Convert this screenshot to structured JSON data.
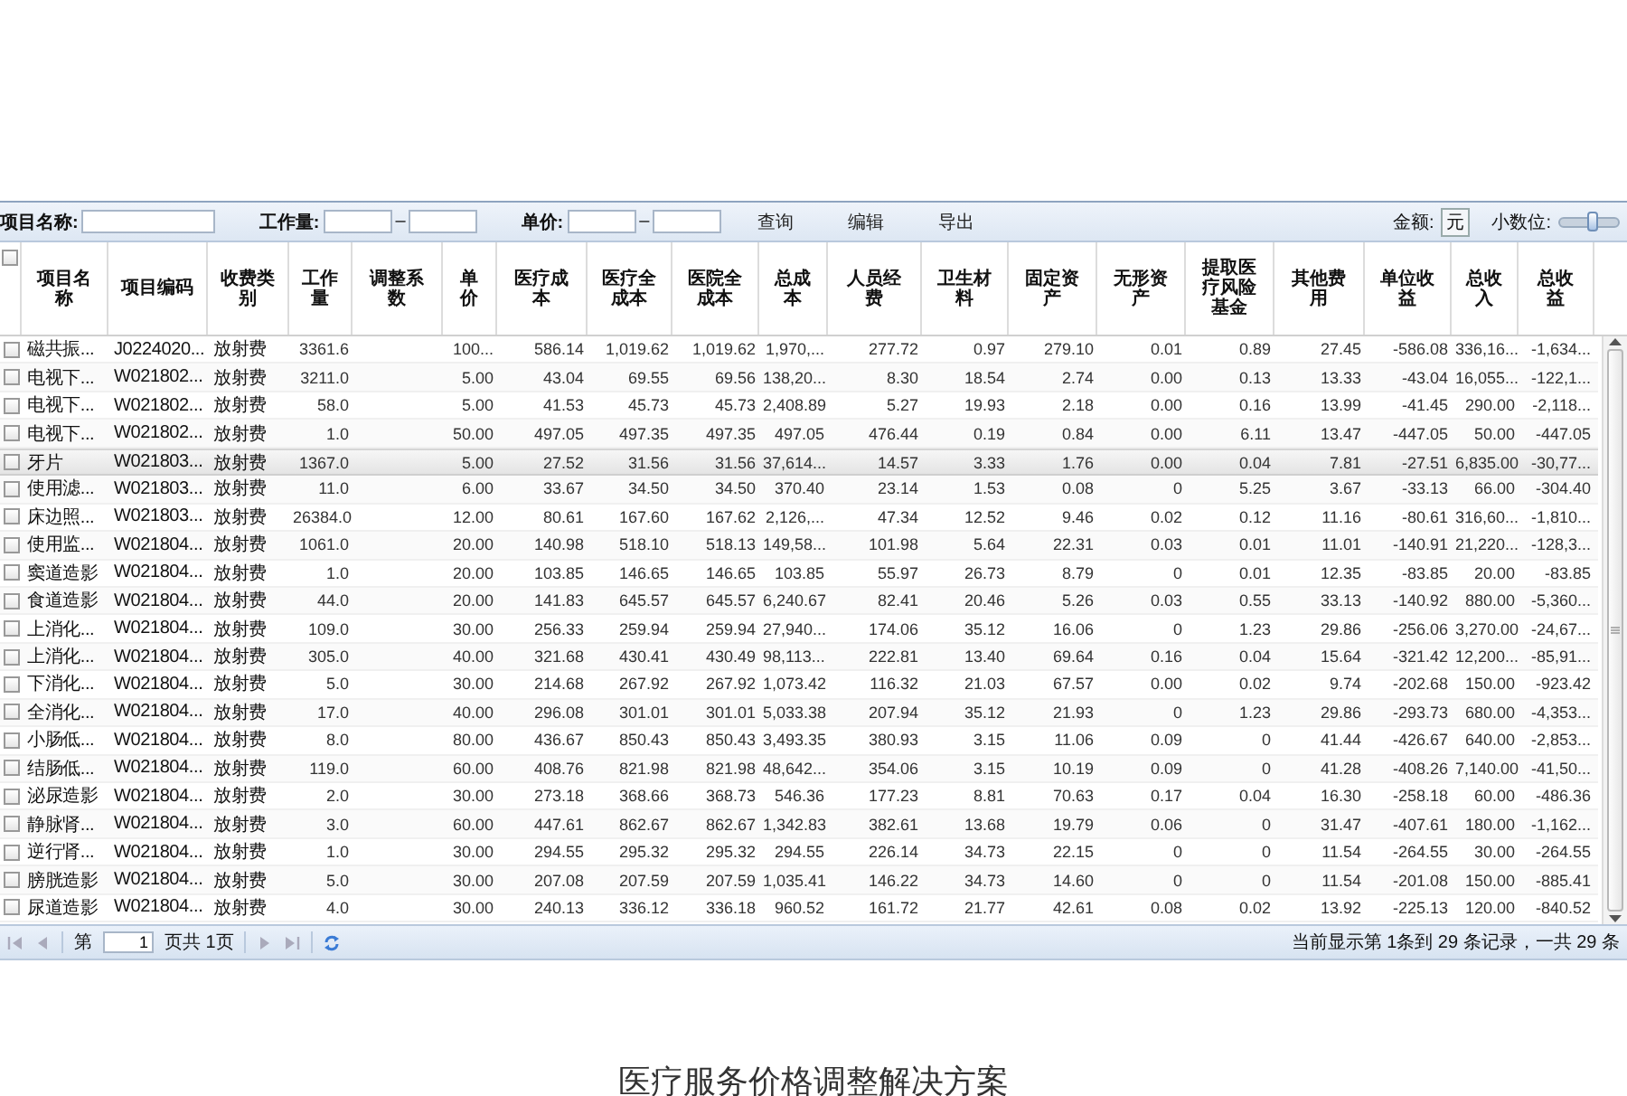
{
  "toolbar": {
    "filters": [
      {
        "label": "项目名称:",
        "kind": "text"
      },
      {
        "label": "工作量:",
        "kind": "range",
        "separator": "–"
      },
      {
        "label": "单价:",
        "kind": "range",
        "separator": "–"
      }
    ],
    "buttons": [
      "查询",
      "编辑",
      "导出"
    ],
    "amount_label": "金额:",
    "amount_unit": "元",
    "decimals_label": "小数位:",
    "decimals_slider": {
      "level": 0.55
    }
  },
  "table": {
    "select_all": {
      "checked": false
    },
    "columns": [
      {
        "label": "项目名称",
        "kind": "text"
      },
      {
        "label": "项目编码",
        "kind": "text"
      },
      {
        "label": "收费类别",
        "kind": "text"
      },
      {
        "label": "工作量",
        "kind": "number"
      },
      {
        "label": "调整系数",
        "kind": "number"
      },
      {
        "label": "单价",
        "kind": "number"
      },
      {
        "label": "医疗成本",
        "kind": "number"
      },
      {
        "label": "医疗全成本",
        "kind": "number"
      },
      {
        "label": "医院全成本",
        "kind": "number"
      },
      {
        "label": "总成本",
        "kind": "number"
      },
      {
        "label": "人员经费",
        "kind": "number"
      },
      {
        "label": "卫生材料",
        "kind": "number"
      },
      {
        "label": "固定资产",
        "kind": "number"
      },
      {
        "label": "无形资产",
        "kind": "number"
      },
      {
        "label": "提取医疗风险基金",
        "kind": "number"
      },
      {
        "label": "其他费用",
        "kind": "number"
      },
      {
        "label": "单位收益",
        "kind": "number"
      },
      {
        "label": "总收入",
        "kind": "number"
      },
      {
        "label": "总收益",
        "kind": "number"
      }
    ],
    "rows": [
      {
        "checked": false,
        "selected": false,
        "cells": [
          "磁共振...",
          "J0224020...",
          "放射费",
          "3361.6",
          null,
          "100...",
          "586.14",
          "1,019.62",
          "1,019.62",
          "1,970,...",
          "277.72",
          "0.97",
          "279.10",
          "0.01",
          "0.89",
          "27.45",
          "-586.08",
          "336,16...",
          "-1,634..."
        ]
      },
      {
        "checked": false,
        "selected": false,
        "cells": [
          "电视下...",
          "W021802...",
          "放射费",
          "3211.0",
          null,
          "5.00",
          "43.04",
          "69.55",
          "69.56",
          "138,20...",
          "8.30",
          "18.54",
          "2.74",
          "0.00",
          "0.13",
          "13.33",
          "-43.04",
          "16,055...",
          "-122,1..."
        ]
      },
      {
        "checked": false,
        "selected": false,
        "cells": [
          "电视下...",
          "W021802...",
          "放射费",
          "58.0",
          null,
          "5.00",
          "41.53",
          "45.73",
          "45.73",
          "2,408.89",
          "5.27",
          "19.93",
          "2.18",
          "0.00",
          "0.16",
          "13.99",
          "-41.45",
          "290.00",
          "-2,118..."
        ]
      },
      {
        "checked": false,
        "selected": false,
        "cells": [
          "电视下...",
          "W021802...",
          "放射费",
          "1.0",
          null,
          "50.00",
          "497.05",
          "497.35",
          "497.35",
          "497.05",
          "476.44",
          "0.19",
          "0.84",
          "0.00",
          "6.11",
          "13.47",
          "-447.05",
          "50.00",
          "-447.05"
        ]
      },
      {
        "checked": false,
        "selected": true,
        "cells": [
          "牙片",
          "W021803...",
          "放射费",
          "1367.0",
          null,
          "5.00",
          "27.52",
          "31.56",
          "31.56",
          "37,614...",
          "14.57",
          "3.33",
          "1.76",
          "0.00",
          "0.04",
          "7.81",
          "-27.51",
          "6,835.00",
          "-30,77..."
        ]
      },
      {
        "checked": false,
        "selected": false,
        "cells": [
          "使用滤...",
          "W021803...",
          "放射费",
          "11.0",
          null,
          "6.00",
          "33.67",
          "34.50",
          "34.50",
          "370.40",
          "23.14",
          "1.53",
          "0.08",
          "0",
          "5.25",
          "3.67",
          "-33.13",
          "66.00",
          "-304.40"
        ]
      },
      {
        "checked": false,
        "selected": false,
        "cells": [
          "床边照...",
          "W021803...",
          "放射费",
          "26384.0",
          null,
          "12.00",
          "80.61",
          "167.60",
          "167.62",
          "2,126,...",
          "47.34",
          "12.52",
          "9.46",
          "0.02",
          "0.12",
          "11.16",
          "-80.61",
          "316,60...",
          "-1,810..."
        ]
      },
      {
        "checked": false,
        "selected": false,
        "cells": [
          "使用监...",
          "W021804...",
          "放射费",
          "1061.0",
          null,
          "20.00",
          "140.98",
          "518.10",
          "518.13",
          "149,58...",
          "101.98",
          "5.64",
          "22.31",
          "0.03",
          "0.01",
          "11.01",
          "-140.91",
          "21,220...",
          "-128,3..."
        ]
      },
      {
        "checked": false,
        "selected": false,
        "cells": [
          "窦道造影",
          "W021804...",
          "放射费",
          "1.0",
          null,
          "20.00",
          "103.85",
          "146.65",
          "146.65",
          "103.85",
          "55.97",
          "26.73",
          "8.79",
          "0",
          "0.01",
          "12.35",
          "-83.85",
          "20.00",
          "-83.85"
        ]
      },
      {
        "checked": false,
        "selected": false,
        "cells": [
          "食道造影",
          "W021804...",
          "放射费",
          "44.0",
          null,
          "20.00",
          "141.83",
          "645.57",
          "645.57",
          "6,240.67",
          "82.41",
          "20.46",
          "5.26",
          "0.03",
          "0.55",
          "33.13",
          "-140.92",
          "880.00",
          "-5,360..."
        ]
      },
      {
        "checked": false,
        "selected": false,
        "cells": [
          "上消化...",
          "W021804...",
          "放射费",
          "109.0",
          null,
          "30.00",
          "256.33",
          "259.94",
          "259.94",
          "27,940...",
          "174.06",
          "35.12",
          "16.06",
          "0",
          "1.23",
          "29.86",
          "-256.06",
          "3,270.00",
          "-24,67..."
        ]
      },
      {
        "checked": false,
        "selected": false,
        "cells": [
          "上消化...",
          "W021804...",
          "放射费",
          "305.0",
          null,
          "40.00",
          "321.68",
          "430.41",
          "430.49",
          "98,113...",
          "222.81",
          "13.40",
          "69.64",
          "0.16",
          "0.04",
          "15.64",
          "-321.42",
          "12,200...",
          "-85,91..."
        ]
      },
      {
        "checked": false,
        "selected": false,
        "cells": [
          "下消化...",
          "W021804...",
          "放射费",
          "5.0",
          null,
          "30.00",
          "214.68",
          "267.92",
          "267.92",
          "1,073.42",
          "116.32",
          "21.03",
          "67.57",
          "0.00",
          "0.02",
          "9.74",
          "-202.68",
          "150.00",
          "-923.42"
        ]
      },
      {
        "checked": false,
        "selected": false,
        "cells": [
          "全消化...",
          "W021804...",
          "放射费",
          "17.0",
          null,
          "40.00",
          "296.08",
          "301.01",
          "301.01",
          "5,033.38",
          "207.94",
          "35.12",
          "21.93",
          "0",
          "1.23",
          "29.86",
          "-293.73",
          "680.00",
          "-4,353..."
        ]
      },
      {
        "checked": false,
        "selected": false,
        "cells": [
          "小肠低...",
          "W021804...",
          "放射费",
          "8.0",
          null,
          "80.00",
          "436.67",
          "850.43",
          "850.43",
          "3,493.35",
          "380.93",
          "3.15",
          "11.06",
          "0.09",
          "0",
          "41.44",
          "-426.67",
          "640.00",
          "-2,853..."
        ]
      },
      {
        "checked": false,
        "selected": false,
        "cells": [
          "结肠低...",
          "W021804...",
          "放射费",
          "119.0",
          null,
          "60.00",
          "408.76",
          "821.98",
          "821.98",
          "48,642...",
          "354.06",
          "3.15",
          "10.19",
          "0.09",
          "0",
          "41.28",
          "-408.26",
          "7,140.00",
          "-41,50..."
        ]
      },
      {
        "checked": false,
        "selected": false,
        "cells": [
          "泌尿造影",
          "W021804...",
          "放射费",
          "2.0",
          null,
          "30.00",
          "273.18",
          "368.66",
          "368.73",
          "546.36",
          "177.23",
          "8.81",
          "70.63",
          "0.17",
          "0.04",
          "16.30",
          "-258.18",
          "60.00",
          "-486.36"
        ]
      },
      {
        "checked": false,
        "selected": false,
        "cells": [
          "静脉肾...",
          "W021804...",
          "放射费",
          "3.0",
          null,
          "60.00",
          "447.61",
          "862.67",
          "862.67",
          "1,342.83",
          "382.61",
          "13.68",
          "19.79",
          "0.06",
          "0",
          "31.47",
          "-407.61",
          "180.00",
          "-1,162..."
        ]
      },
      {
        "checked": false,
        "selected": false,
        "cells": [
          "逆行肾...",
          "W021804...",
          "放射费",
          "1.0",
          null,
          "30.00",
          "294.55",
          "295.32",
          "295.32",
          "294.55",
          "226.14",
          "34.73",
          "22.15",
          "0",
          "0",
          "11.54",
          "-264.55",
          "30.00",
          "-264.55"
        ]
      },
      {
        "checked": false,
        "selected": false,
        "cells": [
          "膀胱造影",
          "W021804...",
          "放射费",
          "5.0",
          null,
          "30.00",
          "207.08",
          "207.59",
          "207.59",
          "1,035.41",
          "146.22",
          "34.73",
          "14.60",
          "0",
          "0",
          "11.54",
          "-201.08",
          "150.00",
          "-885.41"
        ]
      },
      {
        "checked": false,
        "selected": false,
        "cells": [
          "尿道造影",
          "W021804...",
          "放射费",
          "4.0",
          null,
          "30.00",
          "240.13",
          "336.12",
          "336.18",
          "960.52",
          "161.72",
          "21.77",
          "42.61",
          "0.08",
          "0.02",
          "13.92",
          "-225.13",
          "120.00",
          "-840.52"
        ]
      }
    ]
  },
  "pager": {
    "page_prefix": "第",
    "page_value": "1",
    "page_suffix": "页共 1页",
    "summary": "当前显示第 1条到 29 条记录，一共 29 条"
  },
  "caption": "医疗服务价格调整解决方案"
}
